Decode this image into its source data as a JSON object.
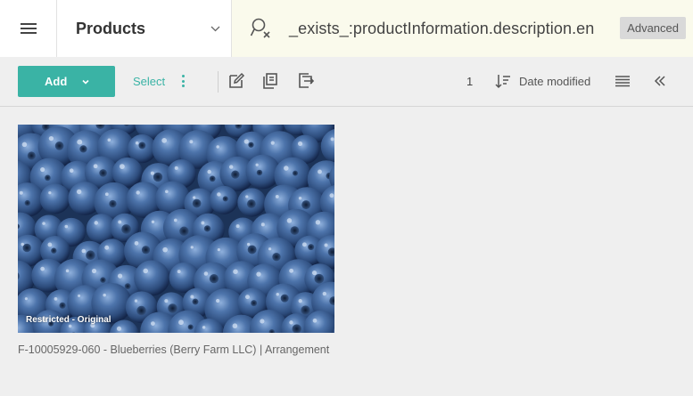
{
  "header": {
    "context_title": "Products",
    "search_query": "_exists_:productInformation.description.en",
    "advanced_label": "Advanced"
  },
  "toolbar": {
    "add_label": "Add",
    "select_label": "Select",
    "result_count": "1",
    "sort_label": "Date modified"
  },
  "results": {
    "items": [
      {
        "badge": "Restricted - Original",
        "caption": "F-10005929-060 - Blueberries (Berry Farm LLC) | Arrangement"
      }
    ]
  },
  "colors": {
    "accent": "#3ab3a5",
    "search_bg": "#fafaec"
  }
}
